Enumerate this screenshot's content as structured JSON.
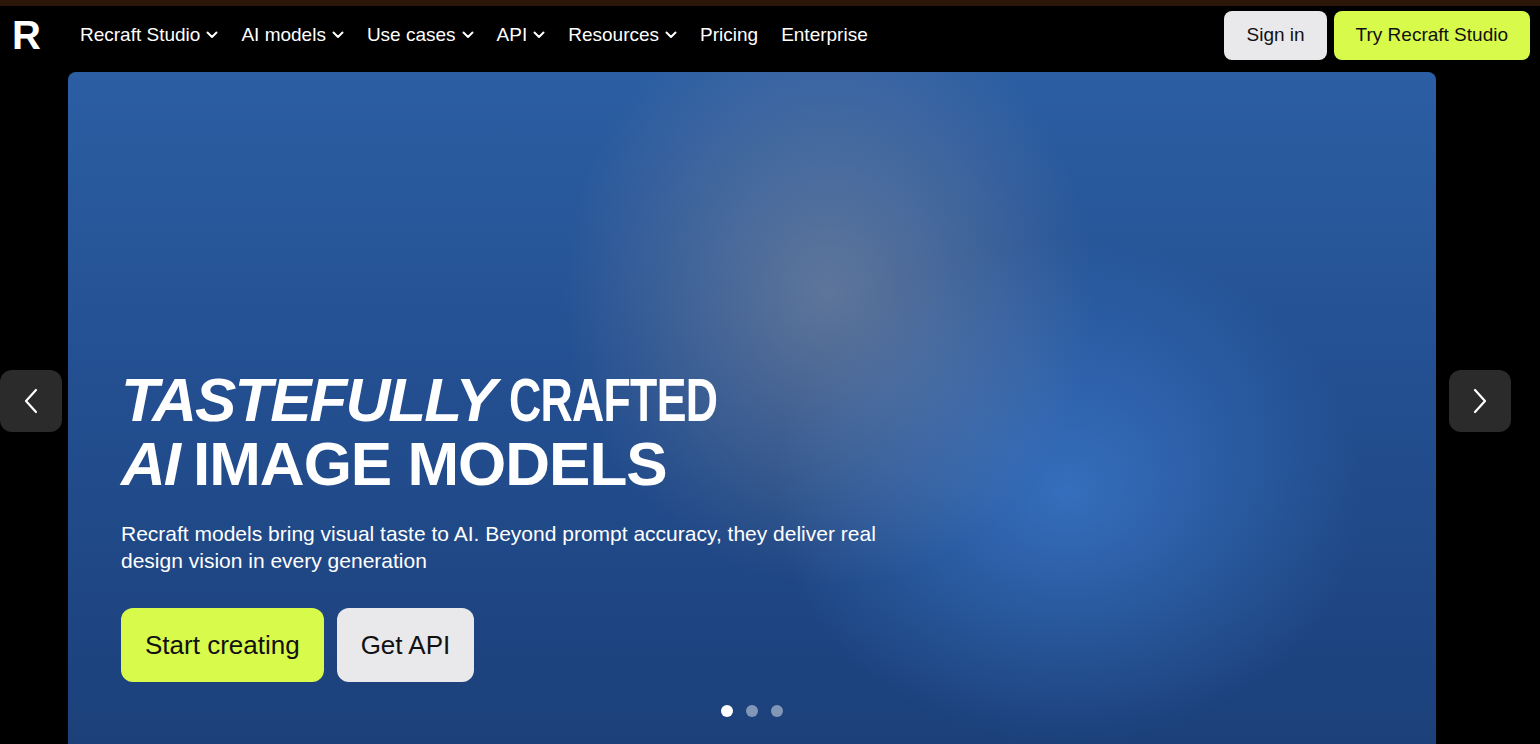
{
  "logo": {
    "text": "R"
  },
  "nav": {
    "items": [
      {
        "label": "Recraft Studio",
        "dropdown": true
      },
      {
        "label": "AI models",
        "dropdown": true
      },
      {
        "label": "Use cases",
        "dropdown": true
      },
      {
        "label": "API",
        "dropdown": true
      },
      {
        "label": "Resources",
        "dropdown": true
      },
      {
        "label": "Pricing",
        "dropdown": false
      },
      {
        "label": "Enterprise",
        "dropdown": false
      }
    ]
  },
  "actions": [
    {
      "label": "Sign in",
      "kind": "secondary"
    },
    {
      "label": "Try Recraft Studio",
      "kind": "primary"
    }
  ],
  "hero": {
    "headline": [
      [
        {
          "text": "TASTEFULLY",
          "kind": "italic"
        },
        {
          "text": "CRAFTED",
          "kind": "condensed"
        }
      ],
      [
        {
          "text": "AI",
          "kind": "italic"
        },
        {
          "text": "IMAGE MODELS",
          "kind": "plain"
        }
      ]
    ],
    "subtitle": "Recraft models bring visual taste to AI. Beyond prompt accuracy, they deliver real design vision in every generation",
    "buttons": [
      {
        "label": "Start creating",
        "kind": "primary"
      },
      {
        "label": "Get API",
        "kind": "secondary"
      }
    ]
  },
  "carousel": {
    "slides": [
      {
        "selected": true
      },
      {
        "selected": false
      },
      {
        "selected": false
      }
    ]
  }
}
